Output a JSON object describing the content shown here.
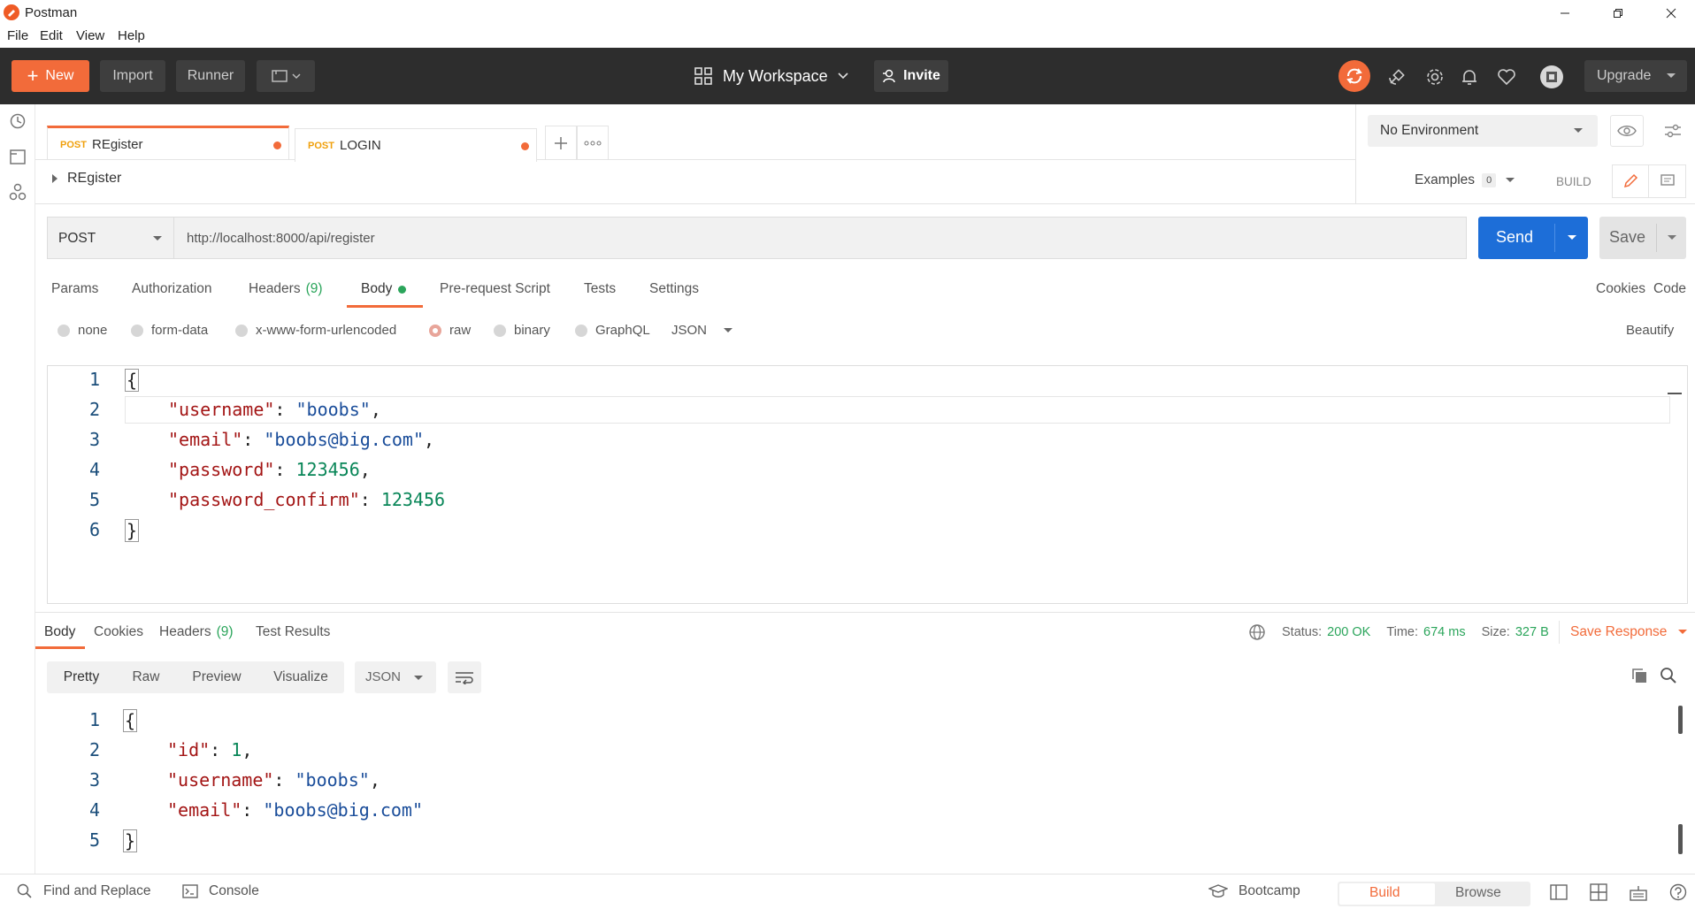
{
  "window": {
    "title": "Postman"
  },
  "menu": [
    "File",
    "Edit",
    "View",
    "Help"
  ],
  "toolbar": {
    "new_label": "New",
    "import_label": "Import",
    "runner_label": "Runner",
    "workspace_label": "My Workspace",
    "invite_label": "Invite",
    "upgrade_label": "Upgrade"
  },
  "tabs": [
    {
      "method": "POST",
      "name": "REgister"
    },
    {
      "method": "POST",
      "name": "LOGIN"
    }
  ],
  "environment": {
    "selected": "No Environment"
  },
  "request": {
    "name": "REgister",
    "examples_label": "Examples",
    "examples_count": "0",
    "build_label": "BUILD",
    "method": "POST",
    "url": "http://localhost:8000/api/register",
    "send_label": "Send",
    "save_label": "Save"
  },
  "request_tabs": {
    "params": "Params",
    "authorization": "Authorization",
    "headers": "Headers",
    "headers_count": "(9)",
    "body": "Body",
    "prerequest": "Pre-request Script",
    "tests": "Tests",
    "settings": "Settings",
    "cookies": "Cookies",
    "code": "Code"
  },
  "body_modes": {
    "none": "none",
    "form_data": "form-data",
    "urlencoded": "x-www-form-urlencoded",
    "raw": "raw",
    "binary": "binary",
    "graphql": "GraphQL",
    "format": "JSON",
    "beautify": "Beautify"
  },
  "request_body": {
    "line_numbers": [
      "1",
      "2",
      "3",
      "4",
      "5",
      "6"
    ],
    "open_brace": "{",
    "close_brace": "}",
    "fields": [
      {
        "key": "\"username\"",
        "value": "\"boobs\"",
        "suffix": ",",
        "type": "string"
      },
      {
        "key": "\"email\"",
        "value": "\"boobs@big.com\"",
        "suffix": ",",
        "type": "string"
      },
      {
        "key": "\"password\"",
        "value": "123456",
        "suffix": ",",
        "type": "number"
      },
      {
        "key": "\"password_confirm\"",
        "value": "123456",
        "suffix": "",
        "type": "number"
      }
    ]
  },
  "response_tabs": {
    "body": "Body",
    "cookies": "Cookies",
    "headers": "Headers",
    "headers_count": "(9)",
    "test_results": "Test Results"
  },
  "response_meta": {
    "status_label": "Status:",
    "status_value": "200 OK",
    "time_label": "Time:",
    "time_value": "674 ms",
    "size_label": "Size:",
    "size_value": "327 B",
    "save_response": "Save Response"
  },
  "response_view": {
    "pretty": "Pretty",
    "raw": "Raw",
    "preview": "Preview",
    "visualize": "Visualize",
    "format": "JSON"
  },
  "response_body": {
    "line_numbers": [
      "1",
      "2",
      "3",
      "4",
      "5"
    ],
    "open_brace": "{",
    "close_brace": "}",
    "fields": [
      {
        "key": "\"id\"",
        "value": "1",
        "suffix": ",",
        "type": "number"
      },
      {
        "key": "\"username\"",
        "value": "\"boobs\"",
        "suffix": ",",
        "type": "string"
      },
      {
        "key": "\"email\"",
        "value": "\"boobs@big.com\"",
        "suffix": "",
        "type": "string"
      }
    ]
  },
  "statusbar": {
    "find_replace": "Find and Replace",
    "console": "Console",
    "bootcamp": "Bootcamp",
    "build": "Build",
    "browse": "Browse"
  },
  "colors": {
    "accent": "#f26b3a",
    "send_blue": "#1d6ed8",
    "success_green": "#2ba55b",
    "toolbar_bg": "#2d2d2d"
  }
}
